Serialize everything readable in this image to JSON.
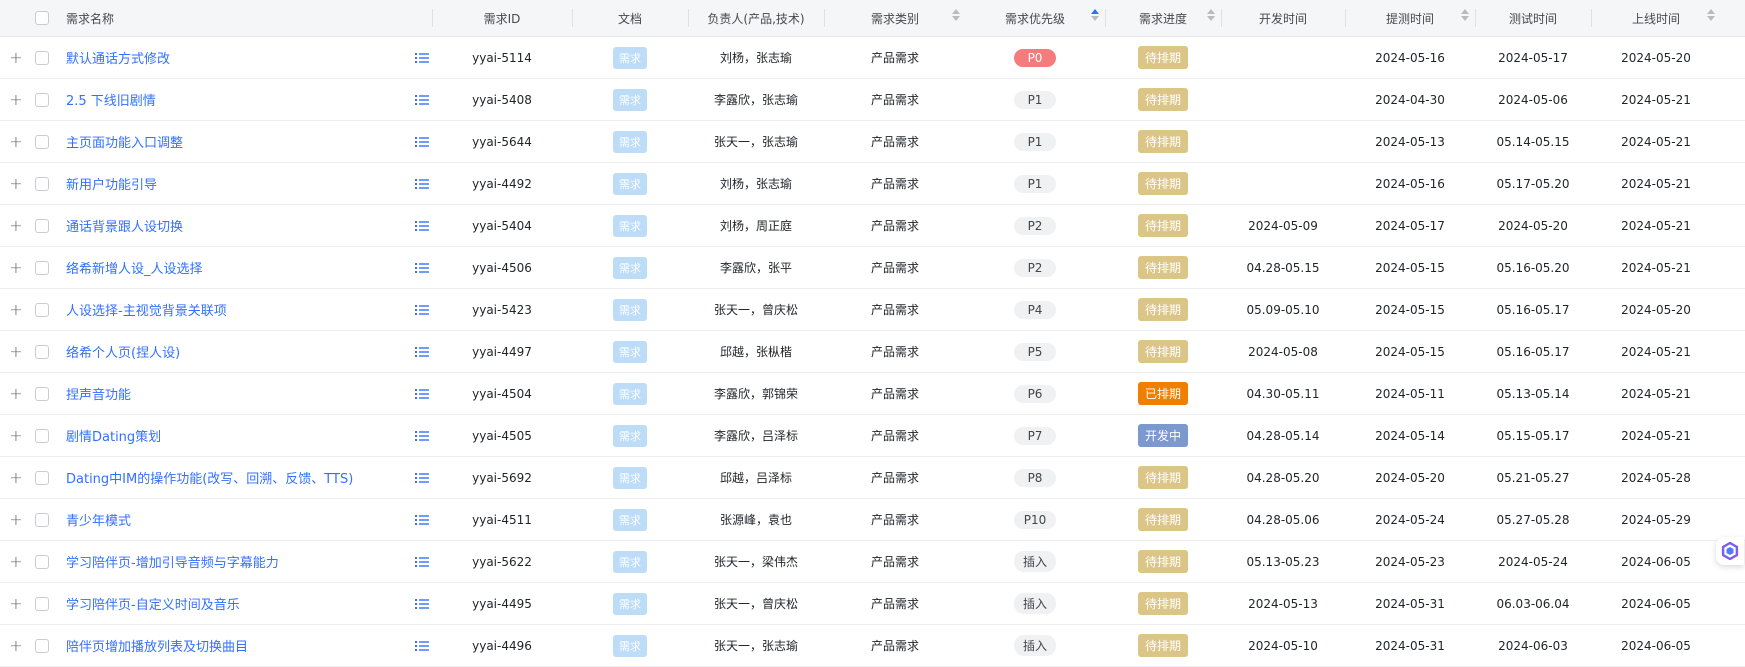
{
  "columns": {
    "name": "需求名称",
    "id": "需求ID",
    "doc": "文档",
    "owner": "负责人(产品,技术)",
    "type": "需求类别",
    "priority": "需求优先级",
    "progress": "需求进度",
    "dev_time": "开发时间",
    "test_submit_time": "提测时间",
    "test_time": "测试时间",
    "release_time": "上线时间"
  },
  "icons": {
    "expand": "plus-icon",
    "detail": "list-icon",
    "sort": "sort-arrows-icon",
    "float": "app-logo-icon"
  },
  "colors": {
    "link": "#3370ff",
    "doc_tag": "#bcdcf7",
    "p0": "#f47c7c",
    "status_pending": "#dbc688",
    "status_scheduled": "#f07f00",
    "status_dev": "#7b98cf"
  },
  "sort": {
    "priority": "ascending"
  },
  "rows": [
    {
      "expand": "+",
      "name": "默认通话方式修改",
      "id": "yyai-5114",
      "doc": "需求",
      "owner": "刘杨，张志瑜",
      "type": "产品需求",
      "priority": "P0",
      "progress": "待排期",
      "dev_time": "",
      "test_submit_time": "2024-05-16",
      "test_time": "2024-05-17",
      "release_time": "2024-05-20"
    },
    {
      "expand": "+",
      "name": "2.5 下线旧剧情",
      "id": "yyai-5408",
      "doc": "需求",
      "owner": "李露欣，张志瑜",
      "type": "产品需求",
      "priority": "P1",
      "progress": "待排期",
      "dev_time": "",
      "test_submit_time": "2024-04-30",
      "test_time": "2024-05-06",
      "release_time": "2024-05-21"
    },
    {
      "expand": "+",
      "name": "主页面功能入口调整",
      "id": "yyai-5644",
      "doc": "需求",
      "owner": "张天一，张志瑜",
      "type": "产品需求",
      "priority": "P1",
      "progress": "待排期",
      "dev_time": "",
      "test_submit_time": "2024-05-13",
      "test_time": "05.14-05.15",
      "release_time": "2024-05-21"
    },
    {
      "expand": "+",
      "name": "新用户功能引导",
      "id": "yyai-4492",
      "doc": "需求",
      "owner": "刘杨，张志瑜",
      "type": "产品需求",
      "priority": "P1",
      "progress": "待排期",
      "dev_time": "",
      "test_submit_time": "2024-05-16",
      "test_time": "05.17-05.20",
      "release_time": "2024-05-21"
    },
    {
      "expand": "+",
      "name": "通话背景跟人设切换",
      "id": "yyai-5404",
      "doc": "需求",
      "owner": "刘杨，周正庭",
      "type": "产品需求",
      "priority": "P2",
      "progress": "待排期",
      "dev_time": "2024-05-09",
      "test_submit_time": "2024-05-17",
      "test_time": "2024-05-20",
      "release_time": "2024-05-21"
    },
    {
      "expand": "+",
      "name": "络希新增人设_人设选择",
      "id": "yyai-4506",
      "doc": "需求",
      "owner": "李露欣，张平",
      "type": "产品需求",
      "priority": "P2",
      "progress": "待排期",
      "dev_time": "04.28-05.15",
      "test_submit_time": "2024-05-15",
      "test_time": "05.16-05.20",
      "release_time": "2024-05-21"
    },
    {
      "expand": "+",
      "name": "人设选择-主视觉背景关联项",
      "id": "yyai-5423",
      "doc": "需求",
      "owner": "张天一，曾庆松",
      "type": "产品需求",
      "priority": "P4",
      "progress": "待排期",
      "dev_time": "05.09-05.10",
      "test_submit_time": "2024-05-15",
      "test_time": "05.16-05.17",
      "release_time": "2024-05-20"
    },
    {
      "expand": "+",
      "name": "络希个人页(捏人设)",
      "id": "yyai-4497",
      "doc": "需求",
      "owner": "邱越，张枞楷",
      "type": "产品需求",
      "priority": "P5",
      "progress": "待排期",
      "dev_time": "2024-05-08",
      "test_submit_time": "2024-05-15",
      "test_time": "05.16-05.17",
      "release_time": "2024-05-21"
    },
    {
      "expand": "+",
      "name": "捏声音功能",
      "id": "yyai-4504",
      "doc": "需求",
      "owner": "李露欣，郭锦荣",
      "type": "产品需求",
      "priority": "P6",
      "progress": "已排期",
      "dev_time": "04.30-05.11",
      "test_submit_time": "2024-05-11",
      "test_time": "05.13-05.14",
      "release_time": "2024-05-21"
    },
    {
      "expand": "+",
      "name": "剧情Dating策划",
      "id": "yyai-4505",
      "doc": "需求",
      "owner": "李露欣，吕泽标",
      "type": "产品需求",
      "priority": "P7",
      "progress": "开发中",
      "dev_time": "04.28-05.14",
      "test_submit_time": "2024-05-14",
      "test_time": "05.15-05.17",
      "release_time": "2024-05-21"
    },
    {
      "expand": "+",
      "name": "Dating中IM的操作功能(改写、回溯、反馈、TTS)",
      "id": "yyai-5692",
      "doc": "需求",
      "owner": "邱越，吕泽标",
      "type": "产品需求",
      "priority": "P8",
      "progress": "待排期",
      "dev_time": "04.28-05.20",
      "test_submit_time": "2024-05-20",
      "test_time": "05.21-05.27",
      "release_time": "2024-05-28"
    },
    {
      "expand": "+",
      "name": "青少年模式",
      "id": "yyai-4511",
      "doc": "需求",
      "owner": "张源峰，袁也",
      "type": "产品需求",
      "priority": "P10",
      "progress": "待排期",
      "dev_time": "04.28-05.06",
      "test_submit_time": "2024-05-24",
      "test_time": "05.27-05.28",
      "release_time": "2024-05-29"
    },
    {
      "expand": "+",
      "name": "学习陪伴页-增加引导音频与字幕能力",
      "id": "yyai-5622",
      "doc": "需求",
      "owner": "张天一，梁伟杰",
      "type": "产品需求",
      "priority": "插入",
      "progress": "待排期",
      "dev_time": "05.13-05.23",
      "test_submit_time": "2024-05-23",
      "test_time": "2024-05-24",
      "release_time": "2024-06-05"
    },
    {
      "expand": "+",
      "name": "学习陪伴页-自定义时间及音乐",
      "id": "yyai-4495",
      "doc": "需求",
      "owner": "张天一，曾庆松",
      "type": "产品需求",
      "priority": "插入",
      "progress": "待排期",
      "dev_time": "2024-05-13",
      "test_submit_time": "2024-05-31",
      "test_time": "06.03-06.04",
      "release_time": "2024-06-05"
    },
    {
      "expand": "+",
      "name": "陪伴页增加播放列表及切换曲目",
      "id": "yyai-4496",
      "doc": "需求",
      "owner": "张天一，张志瑜",
      "type": "产品需求",
      "priority": "插入",
      "progress": "待排期",
      "dev_time": "2024-05-10",
      "test_submit_time": "2024-05-31",
      "test_time": "2024-06-03",
      "release_time": "2024-06-05"
    }
  ]
}
